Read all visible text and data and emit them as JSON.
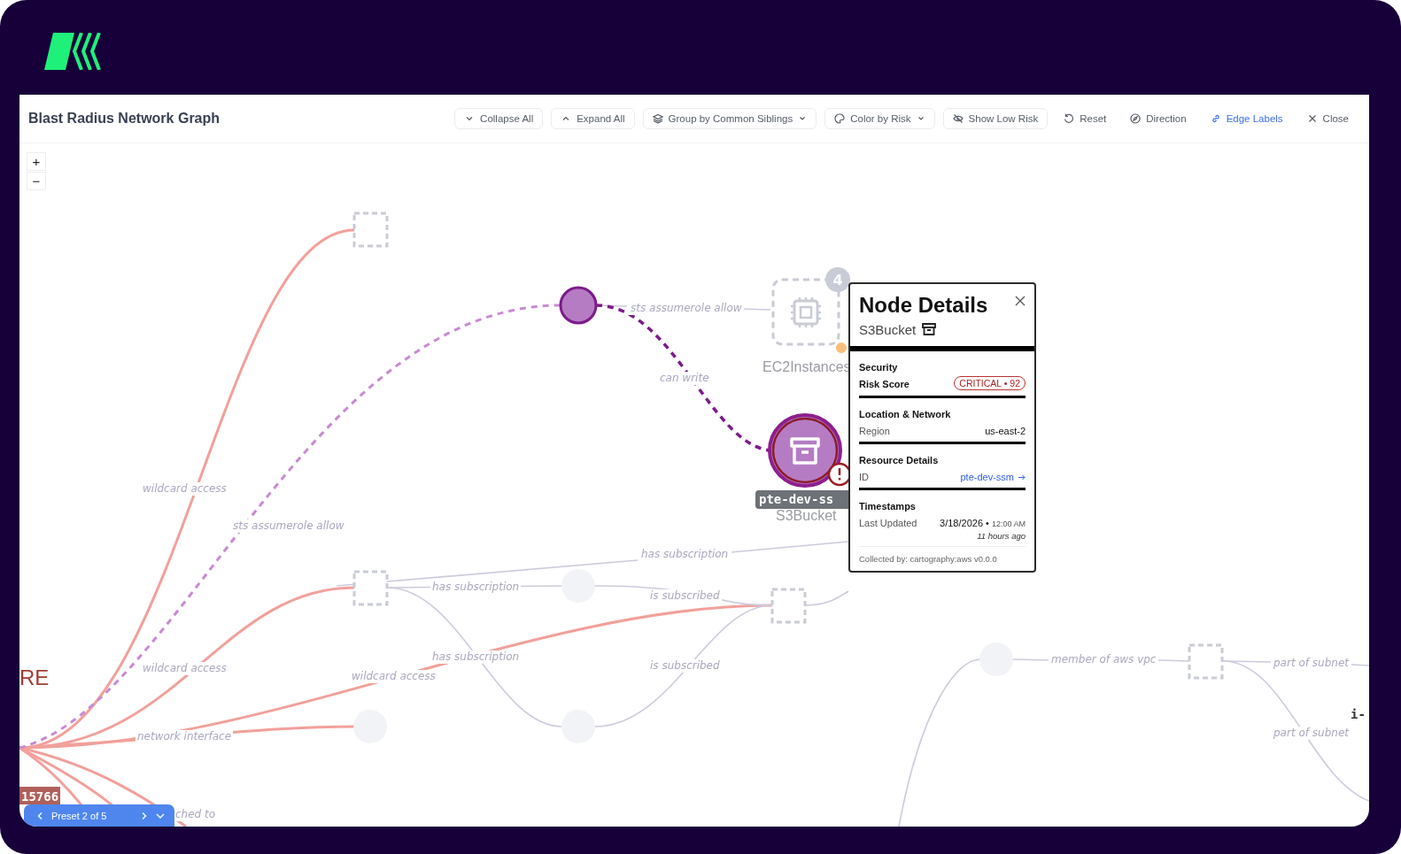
{
  "header": {
    "title": "Blast Radius Network Graph",
    "toolbar": [
      {
        "label": "Collapse All",
        "kind": "bordered",
        "dropdown": false,
        "active": false
      },
      {
        "label": "Expand All",
        "kind": "bordered",
        "dropdown": false,
        "active": false
      },
      {
        "label": "Group by Common Siblings",
        "kind": "bordered",
        "dropdown": true,
        "active": false
      },
      {
        "label": "Color by Risk",
        "kind": "bordered",
        "dropdown": true,
        "active": false
      },
      {
        "label": "Show Low Risk",
        "kind": "bordered",
        "dropdown": false,
        "active": false
      },
      {
        "label": "Reset",
        "kind": "plain",
        "dropdown": false,
        "active": false
      },
      {
        "label": "Direction",
        "kind": "plain",
        "dropdown": false,
        "active": false
      },
      {
        "label": "Edge Labels",
        "kind": "plain",
        "dropdown": false,
        "active": true
      },
      {
        "label": "Close",
        "kind": "plain",
        "dropdown": false,
        "active": false
      }
    ]
  },
  "zoom_controls": [
    "+",
    "−"
  ],
  "graph": {
    "edge_labels": [
      "sts assumerole allow",
      "can write",
      "wildcard access",
      "sts assumerole allow",
      "has subscription",
      "has subscription",
      "is subscribed",
      "wildcard access",
      "wildcard access",
      "has subscription",
      "is subscribed",
      "member of aws vpc",
      "part of subnet",
      "network interface",
      "part of subnet",
      "ched to"
    ],
    "ec2_node": {
      "label": "EC2Instances",
      "count": "4"
    },
    "s3_node": {
      "id_label": "pte-dev-ss",
      "type_label": "S3Bucket",
      "alert": true
    },
    "cut_labels": [
      {
        "text": "RE",
        "kind": "risk-text"
      },
      {
        "text": "15766",
        "kind": "id-badge"
      },
      {
        "text": "i-",
        "kind": "id-label"
      }
    ]
  },
  "node_details": {
    "title": "Node Details",
    "type": "S3Bucket",
    "sections": [
      {
        "heading": "Security",
        "rows": [
          {
            "label": "Risk Score",
            "kind": "badge",
            "value": "CRITICAL • 92"
          }
        ]
      },
      {
        "heading": "Location & Network",
        "rows": [
          {
            "label": "Region",
            "kind": "text",
            "value": "us-east-2"
          }
        ]
      },
      {
        "heading": "Resource Details",
        "rows": [
          {
            "label": "ID",
            "kind": "link",
            "value": "pte-dev-ssm"
          }
        ]
      },
      {
        "heading": "Timestamps",
        "rows": [
          {
            "label": "Last Updated",
            "kind": "timestamp",
            "value": "3/18/2026 •",
            "time": "12:00 AM",
            "ago": "11 hours ago"
          }
        ]
      }
    ],
    "footer": "Collected by: cartography:aws v0.0.0"
  },
  "preset_bar": {
    "label": "Preset 2 of 5"
  }
}
